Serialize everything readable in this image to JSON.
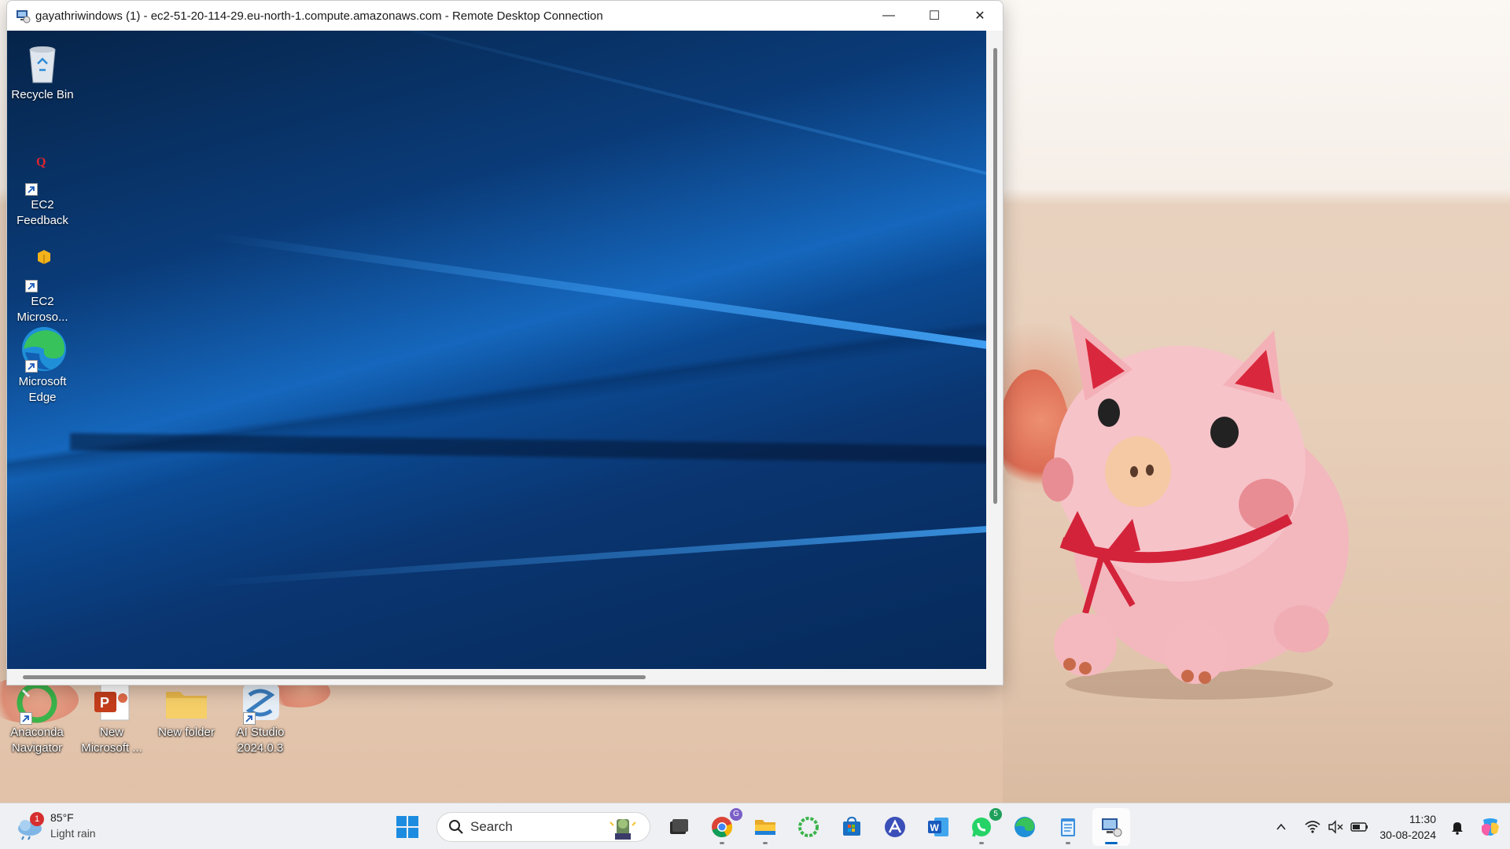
{
  "rdp_window": {
    "title": "gayathriwindows (1) - ec2-51-20-114-29.eu-north-1.compute.amazonaws.com - Remote Desktop Connection",
    "controls": {
      "minimize": "—",
      "maximize": "☐",
      "close": "✕"
    }
  },
  "remote_desktop": {
    "icons": [
      {
        "label": "Recycle Bin",
        "icon": "recycle-bin-icon"
      },
      {
        "label": "EC2 Feedback",
        "icon": "ec2-feedback-icon"
      },
      {
        "label": "EC2 Microso...",
        "icon": "ec2-microsoft-icon"
      },
      {
        "label": "Microsoft Edge",
        "icon": "edge-icon"
      }
    ]
  },
  "host_desktop": {
    "icons": [
      {
        "label": "Anaconda Navigator",
        "icon": "anaconda-icon"
      },
      {
        "label": "New Microsoft ...",
        "icon": "powerpoint-file-icon"
      },
      {
        "label": "New folder",
        "icon": "folder-icon"
      },
      {
        "label": "AI Studio 2024.0.3",
        "icon": "ai-studio-icon"
      }
    ]
  },
  "taskbar": {
    "weather": {
      "temp": "85°F",
      "condition": "Light rain",
      "badge": "1"
    },
    "search_label": "Search",
    "apps": [
      {
        "name": "task-view",
        "badge": ""
      },
      {
        "name": "chrome",
        "badge": ""
      },
      {
        "name": "file-explorer",
        "badge": ""
      },
      {
        "name": "anaconda",
        "badge": ""
      },
      {
        "name": "microsoft-store",
        "badge": ""
      },
      {
        "name": "app-a",
        "badge": ""
      },
      {
        "name": "word",
        "badge": ""
      },
      {
        "name": "whatsapp",
        "badge": "5"
      },
      {
        "name": "edge",
        "badge": ""
      },
      {
        "name": "notepad",
        "badge": ""
      },
      {
        "name": "remote-desktop",
        "badge": ""
      }
    ],
    "clock": {
      "time": "11:30",
      "date": "30-08-2024"
    }
  }
}
